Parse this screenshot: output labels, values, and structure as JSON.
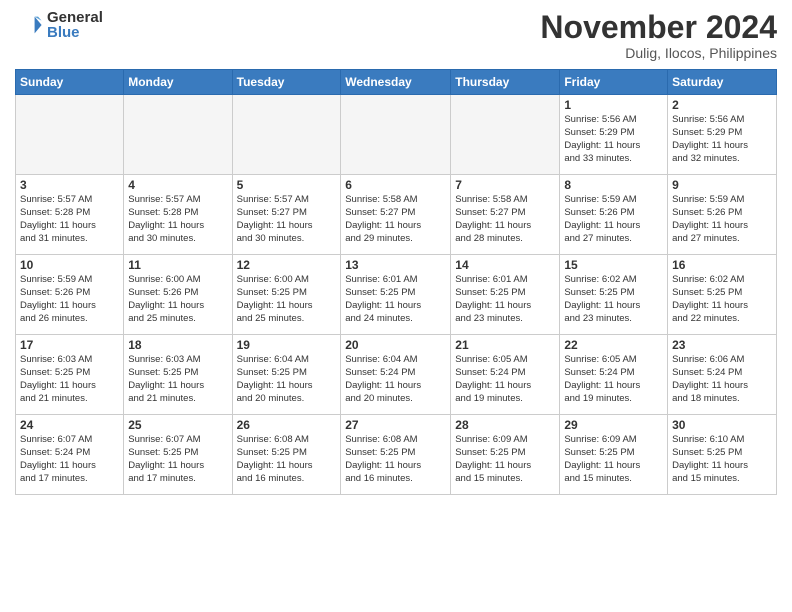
{
  "header": {
    "logo_general": "General",
    "logo_blue": "Blue",
    "month_year": "November 2024",
    "location": "Dulig, Ilocos, Philippines"
  },
  "weekdays": [
    "Sunday",
    "Monday",
    "Tuesday",
    "Wednesday",
    "Thursday",
    "Friday",
    "Saturday"
  ],
  "weeks": [
    [
      {
        "day": "",
        "info": ""
      },
      {
        "day": "",
        "info": ""
      },
      {
        "day": "",
        "info": ""
      },
      {
        "day": "",
        "info": ""
      },
      {
        "day": "",
        "info": ""
      },
      {
        "day": "1",
        "info": "Sunrise: 5:56 AM\nSunset: 5:29 PM\nDaylight: 11 hours\nand 33 minutes."
      },
      {
        "day": "2",
        "info": "Sunrise: 5:56 AM\nSunset: 5:29 PM\nDaylight: 11 hours\nand 32 minutes."
      }
    ],
    [
      {
        "day": "3",
        "info": "Sunrise: 5:57 AM\nSunset: 5:28 PM\nDaylight: 11 hours\nand 31 minutes."
      },
      {
        "day": "4",
        "info": "Sunrise: 5:57 AM\nSunset: 5:28 PM\nDaylight: 11 hours\nand 30 minutes."
      },
      {
        "day": "5",
        "info": "Sunrise: 5:57 AM\nSunset: 5:27 PM\nDaylight: 11 hours\nand 30 minutes."
      },
      {
        "day": "6",
        "info": "Sunrise: 5:58 AM\nSunset: 5:27 PM\nDaylight: 11 hours\nand 29 minutes."
      },
      {
        "day": "7",
        "info": "Sunrise: 5:58 AM\nSunset: 5:27 PM\nDaylight: 11 hours\nand 28 minutes."
      },
      {
        "day": "8",
        "info": "Sunrise: 5:59 AM\nSunset: 5:26 PM\nDaylight: 11 hours\nand 27 minutes."
      },
      {
        "day": "9",
        "info": "Sunrise: 5:59 AM\nSunset: 5:26 PM\nDaylight: 11 hours\nand 27 minutes."
      }
    ],
    [
      {
        "day": "10",
        "info": "Sunrise: 5:59 AM\nSunset: 5:26 PM\nDaylight: 11 hours\nand 26 minutes."
      },
      {
        "day": "11",
        "info": "Sunrise: 6:00 AM\nSunset: 5:26 PM\nDaylight: 11 hours\nand 25 minutes."
      },
      {
        "day": "12",
        "info": "Sunrise: 6:00 AM\nSunset: 5:25 PM\nDaylight: 11 hours\nand 25 minutes."
      },
      {
        "day": "13",
        "info": "Sunrise: 6:01 AM\nSunset: 5:25 PM\nDaylight: 11 hours\nand 24 minutes."
      },
      {
        "day": "14",
        "info": "Sunrise: 6:01 AM\nSunset: 5:25 PM\nDaylight: 11 hours\nand 23 minutes."
      },
      {
        "day": "15",
        "info": "Sunrise: 6:02 AM\nSunset: 5:25 PM\nDaylight: 11 hours\nand 23 minutes."
      },
      {
        "day": "16",
        "info": "Sunrise: 6:02 AM\nSunset: 5:25 PM\nDaylight: 11 hours\nand 22 minutes."
      }
    ],
    [
      {
        "day": "17",
        "info": "Sunrise: 6:03 AM\nSunset: 5:25 PM\nDaylight: 11 hours\nand 21 minutes."
      },
      {
        "day": "18",
        "info": "Sunrise: 6:03 AM\nSunset: 5:25 PM\nDaylight: 11 hours\nand 21 minutes."
      },
      {
        "day": "19",
        "info": "Sunrise: 6:04 AM\nSunset: 5:25 PM\nDaylight: 11 hours\nand 20 minutes."
      },
      {
        "day": "20",
        "info": "Sunrise: 6:04 AM\nSunset: 5:24 PM\nDaylight: 11 hours\nand 20 minutes."
      },
      {
        "day": "21",
        "info": "Sunrise: 6:05 AM\nSunset: 5:24 PM\nDaylight: 11 hours\nand 19 minutes."
      },
      {
        "day": "22",
        "info": "Sunrise: 6:05 AM\nSunset: 5:24 PM\nDaylight: 11 hours\nand 19 minutes."
      },
      {
        "day": "23",
        "info": "Sunrise: 6:06 AM\nSunset: 5:24 PM\nDaylight: 11 hours\nand 18 minutes."
      }
    ],
    [
      {
        "day": "24",
        "info": "Sunrise: 6:07 AM\nSunset: 5:24 PM\nDaylight: 11 hours\nand 17 minutes."
      },
      {
        "day": "25",
        "info": "Sunrise: 6:07 AM\nSunset: 5:25 PM\nDaylight: 11 hours\nand 17 minutes."
      },
      {
        "day": "26",
        "info": "Sunrise: 6:08 AM\nSunset: 5:25 PM\nDaylight: 11 hours\nand 16 minutes."
      },
      {
        "day": "27",
        "info": "Sunrise: 6:08 AM\nSunset: 5:25 PM\nDaylight: 11 hours\nand 16 minutes."
      },
      {
        "day": "28",
        "info": "Sunrise: 6:09 AM\nSunset: 5:25 PM\nDaylight: 11 hours\nand 15 minutes."
      },
      {
        "day": "29",
        "info": "Sunrise: 6:09 AM\nSunset: 5:25 PM\nDaylight: 11 hours\nand 15 minutes."
      },
      {
        "day": "30",
        "info": "Sunrise: 6:10 AM\nSunset: 5:25 PM\nDaylight: 11 hours\nand 15 minutes."
      }
    ]
  ]
}
